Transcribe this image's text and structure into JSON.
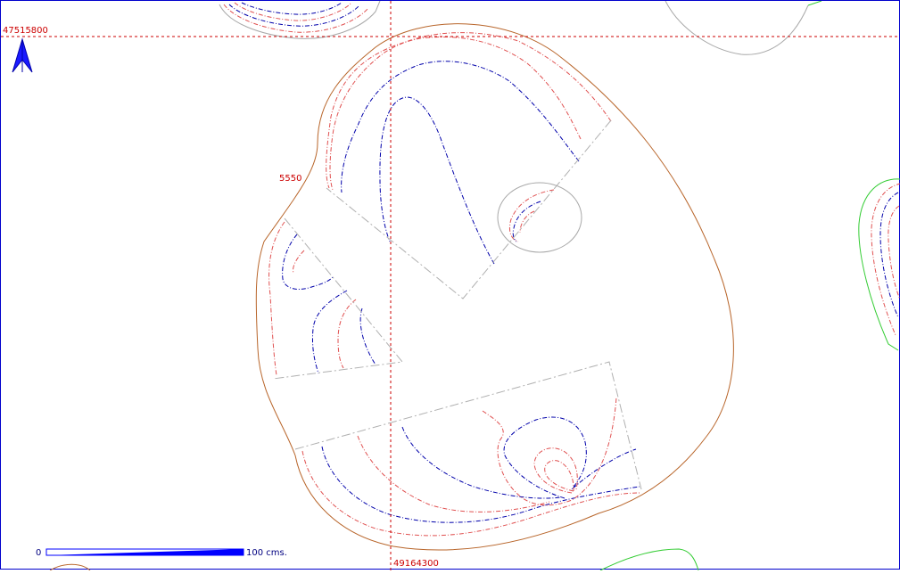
{
  "map": {
    "grid": {
      "northing_label": "47515800",
      "easting_label": "49164300",
      "line_color": "#cc0000"
    },
    "contour_label": "5550",
    "north_arrow": {
      "icon": "north-arrow-icon",
      "color": "#1a1aff"
    },
    "scale_bar": {
      "start_label": "0",
      "end_label": "100 cms.",
      "color": "#0000ff"
    },
    "colors": {
      "outer_contour": "#b8652a",
      "red_contour": "#e05050",
      "blue_contour": "#0000aa",
      "gray_contour": "#a8a8a8",
      "green_contour": "#33cc33",
      "frame": "#0000cc"
    }
  }
}
